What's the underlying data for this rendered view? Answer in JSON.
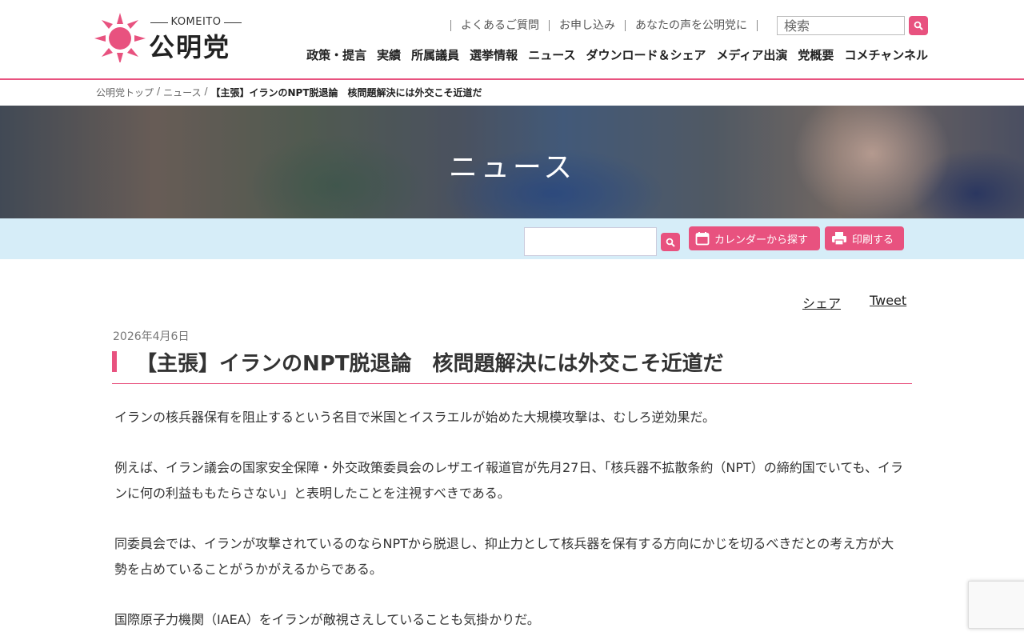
{
  "logo": {
    "en": "KOMEITO",
    "jp": "公明党"
  },
  "utility_links": [
    "よくあるご質問",
    "お申し込み",
    "あなたの声を公明党に"
  ],
  "header_search": {
    "placeholder": "検索"
  },
  "global_nav": [
    "政策・提言",
    "実績",
    "所属議員",
    "選挙情報",
    "ニュース",
    "ダウンロード＆シェア",
    "メディア出演",
    "党概要",
    "コメチャンネル"
  ],
  "breadcrumb": {
    "home": "公明党トップ",
    "section": "ニュース",
    "current": "【主張】イランのNPT脱退論　核問題解決には外交こそ近道だ",
    "separator": "/"
  },
  "hero": {
    "title": "ニュース"
  },
  "toolbar": {
    "calendar_label": "カレンダーから探す",
    "print_label": "印刷する"
  },
  "share": {
    "facebook": "シェア",
    "twitter": "Tweet"
  },
  "article": {
    "date": "2026年4月6日",
    "title": "【主張】イランのNPT脱退論　核問題解決には外交こそ近道だ",
    "paragraphs": [
      "イランの核兵器保有を阻止するという名目で米国とイスラエルが始めた大規模攻撃は、むしろ逆効果だ。",
      "例えば、イラン議会の国家安全保障・外交政策委員会のレザエイ報道官が先月27日、「核兵器不拡散条約（NPT）の締約国でいても、イランに何の利益ももたらさない」と表明したことを注視すべきである。",
      "同委員会では、イランが攻撃されているのならNPTから脱退し、抑止力として核兵器を保有する方向にかじを切るべきだとの考え方が大勢を占めていることがうかがえるからである。",
      "国際原子力機関（IAEA）をイランが敵視さえしていることも気掛かりだ。"
    ]
  },
  "colors": {
    "accent": "#e8527f",
    "toolbar_bg": "#d6edf8"
  }
}
